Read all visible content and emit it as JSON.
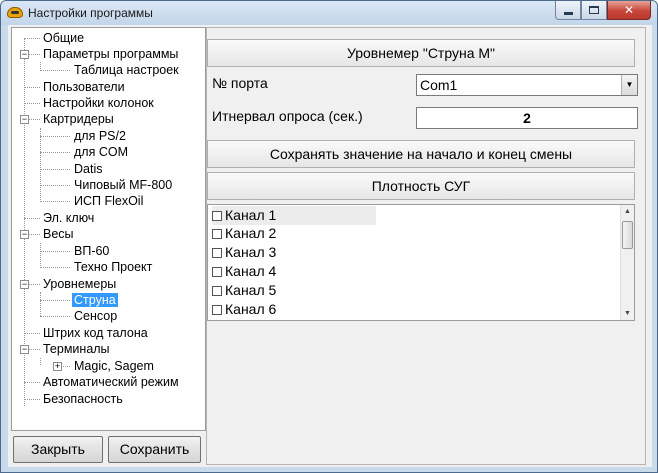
{
  "window": {
    "title": "Настройки программы"
  },
  "tree": {
    "items": [
      {
        "label": "Общие"
      },
      {
        "label": "Параметры программы"
      },
      {
        "label": "Таблица настроек"
      },
      {
        "label": "Пользователи"
      },
      {
        "label": "Настройки колонок"
      },
      {
        "label": "Картридеры"
      },
      {
        "label": "для PS/2"
      },
      {
        "label": "для COM"
      },
      {
        "label": "Datis"
      },
      {
        "label": "Чиповый MF-800"
      },
      {
        "label": "ИСП FlexOil"
      },
      {
        "label": "Эл. ключ"
      },
      {
        "label": "Весы"
      },
      {
        "label": "ВП-60"
      },
      {
        "label": "Техно Проект"
      },
      {
        "label": "Уровнемеры"
      },
      {
        "label": "Струна",
        "selected": true
      },
      {
        "label": "Сенсор"
      },
      {
        "label": "Штрих код талона"
      },
      {
        "label": "Терминалы"
      },
      {
        "label": "Magic, Sagem"
      },
      {
        "label": "Автоматический режим"
      },
      {
        "label": "Безопасность"
      }
    ]
  },
  "buttons": {
    "close": "Закрыть",
    "save": "Сохранить"
  },
  "panel": {
    "title": "Уровнемер \"Струна М\"",
    "port_label": "№ порта",
    "port_value": "Com1",
    "interval_label": "Итнервал опроса (сек.)",
    "interval_value": "2",
    "save_shift_label": "Сохранять значение на начало и конец смены",
    "density_label": "Плотность СУГ",
    "channels": [
      "Канал  1",
      "Канал  2",
      "Канал  3",
      "Канал  4",
      "Канал  5",
      "Канал  6"
    ]
  },
  "colors": {
    "selection": "#3399ff",
    "close_button": "#c8453a",
    "frame": "#c9daea"
  }
}
